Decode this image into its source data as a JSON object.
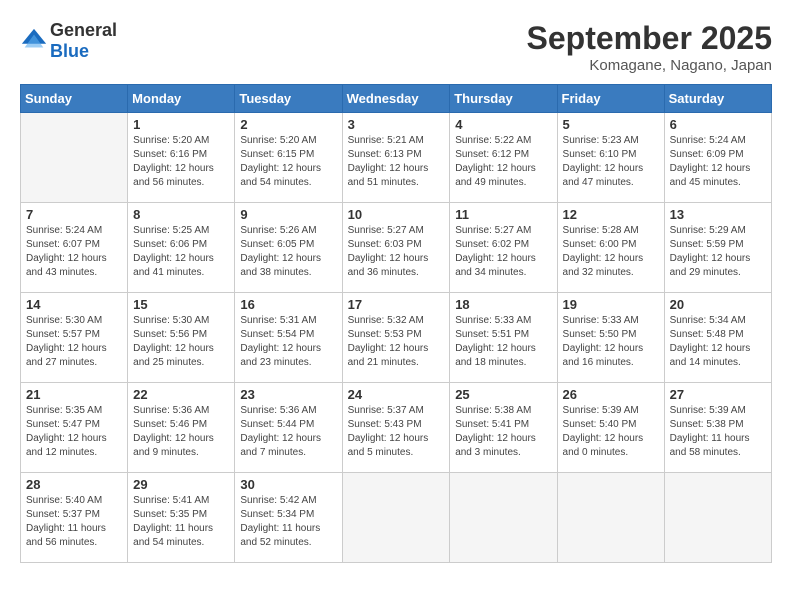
{
  "header": {
    "logo_line1": "General",
    "logo_line2": "Blue",
    "month": "September 2025",
    "location": "Komagane, Nagano, Japan"
  },
  "days_of_week": [
    "Sunday",
    "Monday",
    "Tuesday",
    "Wednesday",
    "Thursday",
    "Friday",
    "Saturday"
  ],
  "weeks": [
    [
      {
        "day": "",
        "empty": true
      },
      {
        "day": "1",
        "sunrise": "Sunrise: 5:20 AM",
        "sunset": "Sunset: 6:16 PM",
        "daylight": "Daylight: 12 hours and 56 minutes."
      },
      {
        "day": "2",
        "sunrise": "Sunrise: 5:20 AM",
        "sunset": "Sunset: 6:15 PM",
        "daylight": "Daylight: 12 hours and 54 minutes."
      },
      {
        "day": "3",
        "sunrise": "Sunrise: 5:21 AM",
        "sunset": "Sunset: 6:13 PM",
        "daylight": "Daylight: 12 hours and 51 minutes."
      },
      {
        "day": "4",
        "sunrise": "Sunrise: 5:22 AM",
        "sunset": "Sunset: 6:12 PM",
        "daylight": "Daylight: 12 hours and 49 minutes."
      },
      {
        "day": "5",
        "sunrise": "Sunrise: 5:23 AM",
        "sunset": "Sunset: 6:10 PM",
        "daylight": "Daylight: 12 hours and 47 minutes."
      },
      {
        "day": "6",
        "sunrise": "Sunrise: 5:24 AM",
        "sunset": "Sunset: 6:09 PM",
        "daylight": "Daylight: 12 hours and 45 minutes."
      }
    ],
    [
      {
        "day": "7",
        "sunrise": "Sunrise: 5:24 AM",
        "sunset": "Sunset: 6:07 PM",
        "daylight": "Daylight: 12 hours and 43 minutes."
      },
      {
        "day": "8",
        "sunrise": "Sunrise: 5:25 AM",
        "sunset": "Sunset: 6:06 PM",
        "daylight": "Daylight: 12 hours and 41 minutes."
      },
      {
        "day": "9",
        "sunrise": "Sunrise: 5:26 AM",
        "sunset": "Sunset: 6:05 PM",
        "daylight": "Daylight: 12 hours and 38 minutes."
      },
      {
        "day": "10",
        "sunrise": "Sunrise: 5:27 AM",
        "sunset": "Sunset: 6:03 PM",
        "daylight": "Daylight: 12 hours and 36 minutes."
      },
      {
        "day": "11",
        "sunrise": "Sunrise: 5:27 AM",
        "sunset": "Sunset: 6:02 PM",
        "daylight": "Daylight: 12 hours and 34 minutes."
      },
      {
        "day": "12",
        "sunrise": "Sunrise: 5:28 AM",
        "sunset": "Sunset: 6:00 PM",
        "daylight": "Daylight: 12 hours and 32 minutes."
      },
      {
        "day": "13",
        "sunrise": "Sunrise: 5:29 AM",
        "sunset": "Sunset: 5:59 PM",
        "daylight": "Daylight: 12 hours and 29 minutes."
      }
    ],
    [
      {
        "day": "14",
        "sunrise": "Sunrise: 5:30 AM",
        "sunset": "Sunset: 5:57 PM",
        "daylight": "Daylight: 12 hours and 27 minutes."
      },
      {
        "day": "15",
        "sunrise": "Sunrise: 5:30 AM",
        "sunset": "Sunset: 5:56 PM",
        "daylight": "Daylight: 12 hours and 25 minutes."
      },
      {
        "day": "16",
        "sunrise": "Sunrise: 5:31 AM",
        "sunset": "Sunset: 5:54 PM",
        "daylight": "Daylight: 12 hours and 23 minutes."
      },
      {
        "day": "17",
        "sunrise": "Sunrise: 5:32 AM",
        "sunset": "Sunset: 5:53 PM",
        "daylight": "Daylight: 12 hours and 21 minutes."
      },
      {
        "day": "18",
        "sunrise": "Sunrise: 5:33 AM",
        "sunset": "Sunset: 5:51 PM",
        "daylight": "Daylight: 12 hours and 18 minutes."
      },
      {
        "day": "19",
        "sunrise": "Sunrise: 5:33 AM",
        "sunset": "Sunset: 5:50 PM",
        "daylight": "Daylight: 12 hours and 16 minutes."
      },
      {
        "day": "20",
        "sunrise": "Sunrise: 5:34 AM",
        "sunset": "Sunset: 5:48 PM",
        "daylight": "Daylight: 12 hours and 14 minutes."
      }
    ],
    [
      {
        "day": "21",
        "sunrise": "Sunrise: 5:35 AM",
        "sunset": "Sunset: 5:47 PM",
        "daylight": "Daylight: 12 hours and 12 minutes."
      },
      {
        "day": "22",
        "sunrise": "Sunrise: 5:36 AM",
        "sunset": "Sunset: 5:46 PM",
        "daylight": "Daylight: 12 hours and 9 minutes."
      },
      {
        "day": "23",
        "sunrise": "Sunrise: 5:36 AM",
        "sunset": "Sunset: 5:44 PM",
        "daylight": "Daylight: 12 hours and 7 minutes."
      },
      {
        "day": "24",
        "sunrise": "Sunrise: 5:37 AM",
        "sunset": "Sunset: 5:43 PM",
        "daylight": "Daylight: 12 hours and 5 minutes."
      },
      {
        "day": "25",
        "sunrise": "Sunrise: 5:38 AM",
        "sunset": "Sunset: 5:41 PM",
        "daylight": "Daylight: 12 hours and 3 minutes."
      },
      {
        "day": "26",
        "sunrise": "Sunrise: 5:39 AM",
        "sunset": "Sunset: 5:40 PM",
        "daylight": "Daylight: 12 hours and 0 minutes."
      },
      {
        "day": "27",
        "sunrise": "Sunrise: 5:39 AM",
        "sunset": "Sunset: 5:38 PM",
        "daylight": "Daylight: 11 hours and 58 minutes."
      }
    ],
    [
      {
        "day": "28",
        "sunrise": "Sunrise: 5:40 AM",
        "sunset": "Sunset: 5:37 PM",
        "daylight": "Daylight: 11 hours and 56 minutes."
      },
      {
        "day": "29",
        "sunrise": "Sunrise: 5:41 AM",
        "sunset": "Sunset: 5:35 PM",
        "daylight": "Daylight: 11 hours and 54 minutes."
      },
      {
        "day": "30",
        "sunrise": "Sunrise: 5:42 AM",
        "sunset": "Sunset: 5:34 PM",
        "daylight": "Daylight: 11 hours and 52 minutes."
      },
      {
        "day": "",
        "empty": true
      },
      {
        "day": "",
        "empty": true
      },
      {
        "day": "",
        "empty": true
      },
      {
        "day": "",
        "empty": true
      }
    ]
  ]
}
